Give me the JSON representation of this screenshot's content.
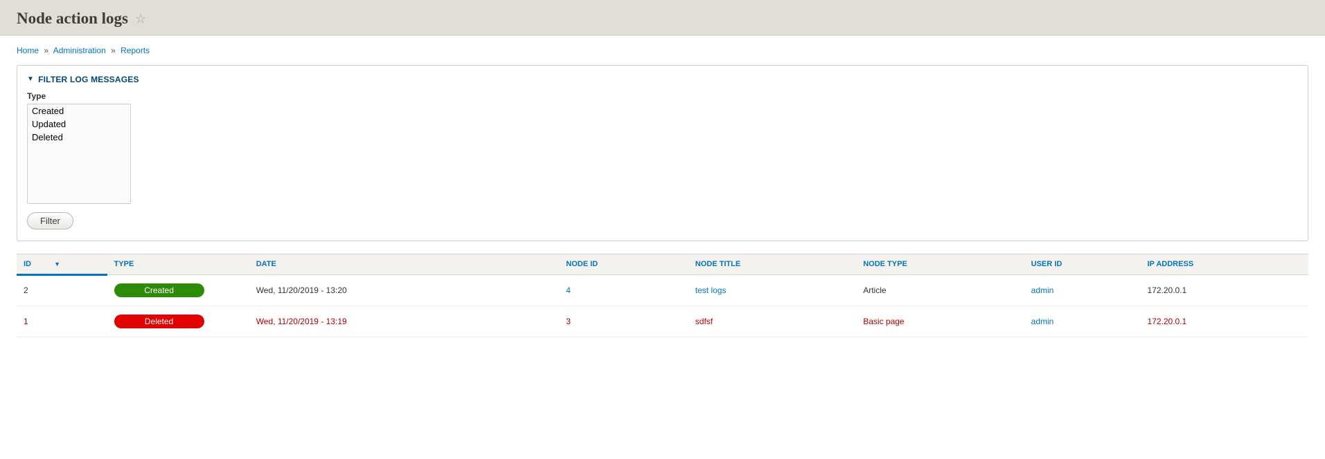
{
  "header": {
    "title": "Node action logs"
  },
  "breadcrumb": {
    "home": "Home",
    "admin": "Administration",
    "reports": "Reports"
  },
  "filter": {
    "legend": "FILTER LOG MESSAGES",
    "type_label": "Type",
    "options": [
      "Created",
      "Updated",
      "Deleted"
    ],
    "button": "Filter"
  },
  "table": {
    "headers": {
      "id": "ID",
      "type": "TYPE",
      "date": "DATE",
      "node_id": "NODE ID",
      "node_title": "NODE TITLE",
      "node_type": "NODE TYPE",
      "user_id": "USER ID",
      "ip": "IP ADDRESS"
    },
    "rows": [
      {
        "id": "2",
        "type": "Created",
        "type_class": "created",
        "date": "Wed, 11/20/2019 - 13:20",
        "node_id": "4",
        "node_title": "test logs",
        "node_type": "Article",
        "user_id": "admin",
        "ip": "172.20.0.1",
        "deleted": false
      },
      {
        "id": "1",
        "type": "Deleted",
        "type_class": "deleted",
        "date": "Wed, 11/20/2019 - 13:19",
        "node_id": "3",
        "node_title": "sdfsf",
        "node_type": "Basic page",
        "user_id": "admin",
        "ip": "172.20.0.1",
        "deleted": true
      }
    ]
  }
}
